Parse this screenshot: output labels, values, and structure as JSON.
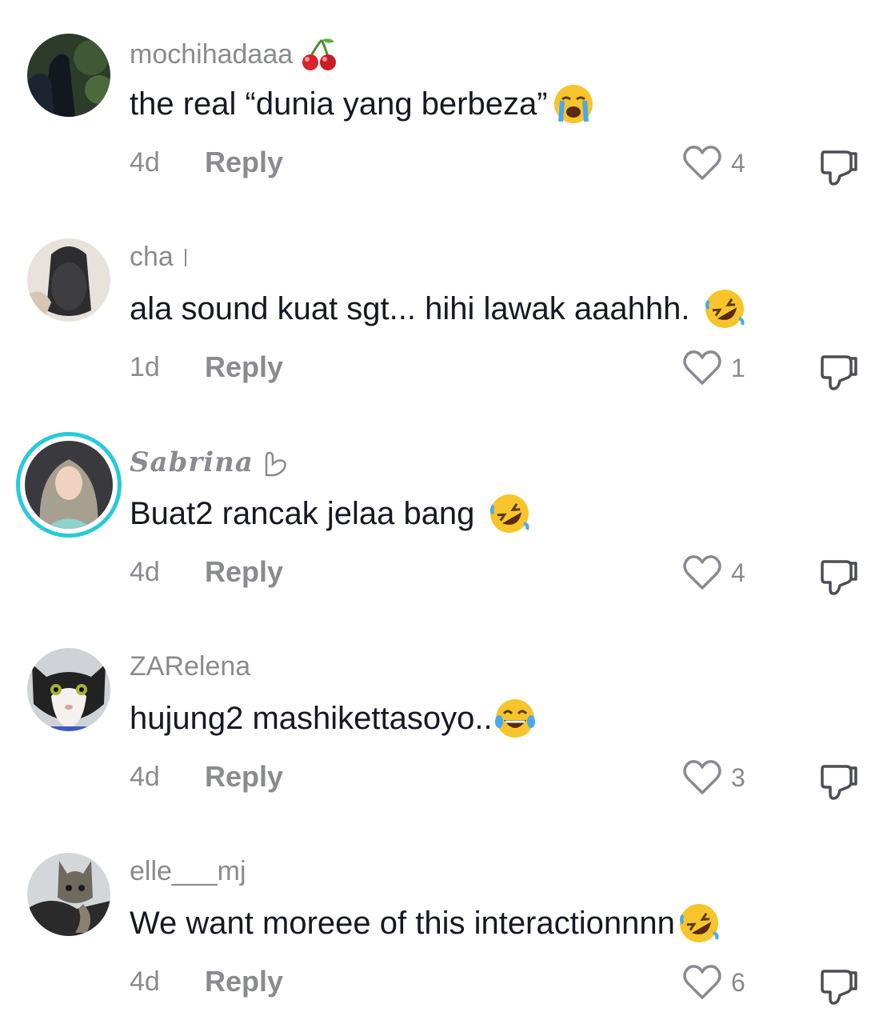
{
  "comments": [
    {
      "username": "mochihadaaa",
      "badge_icon": "cherry-icon",
      "text": "the real “dunia yang berbeza”",
      "emoji": "loudly-crying-face-emoji",
      "time": "4d",
      "reply_label": "Reply",
      "likes": "4"
    },
    {
      "username": "cha",
      "badge_icon": "thin-bar",
      "text": "ala sound kuat sgt... hihi lawak aaahhh.",
      "emoji": "rolling-on-floor-laughing-emoji",
      "time": "1d",
      "reply_label": "Reply",
      "likes": "1"
    },
    {
      "username": "Sabrina",
      "badge_icon": "hand-gesture-icon",
      "text": "Buat2 rancak jelaa bang",
      "emoji": "rolling-on-floor-laughing-emoji",
      "time": "4d",
      "reply_label": "Reply",
      "likes": "4"
    },
    {
      "username": "ZARelena",
      "text": "hujung2 mashikettasoyo..",
      "emoji": "face-with-tears-of-joy-emoji",
      "time": "4d",
      "reply_label": "Reply",
      "likes": "3"
    },
    {
      "username": "elle___mj",
      "text": "We want moreee of this interactionnnn",
      "emoji": "rolling-on-floor-laughing-emoji",
      "time": "4d",
      "reply_label": "Reply",
      "likes": "6"
    }
  ],
  "colors": {
    "text": "#161823",
    "secondary": "#8a8b91",
    "story_ring": "#27c9dd",
    "emoji_yellow": "#f7c52b"
  }
}
